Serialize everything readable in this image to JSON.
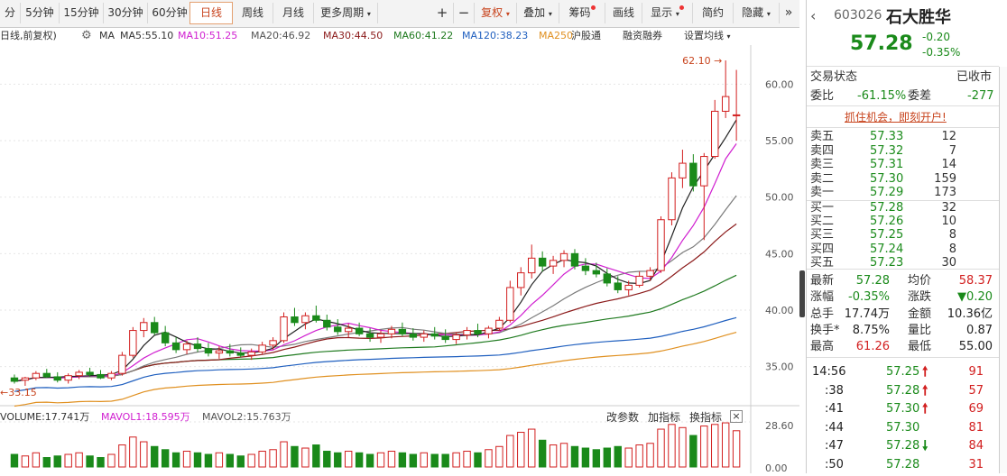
{
  "toolbar": {
    "items": [
      "分",
      "5分钟",
      "15分钟",
      "30分钟",
      "60分钟",
      "日线",
      "周线",
      "月线",
      "更多周期"
    ],
    "active": "日线",
    "plus": "+",
    "minus": "−",
    "fuquan": "复权",
    "diejia": "叠加",
    "chouma": "筹码",
    "huaxian": "画线",
    "xianshi": "显示",
    "jianyue": "简约",
    "yincang": "隐藏"
  },
  "ma_row": {
    "prefix": "日线,前复权)",
    "ma": "MA",
    "ma5": "MA5:55.10",
    "ma10": "MA10:51.25",
    "ma20": "MA20:46.92",
    "ma30": "MA30:44.50",
    "ma60": "MA60:41.22",
    "ma120": "MA120:38.23",
    "ma250": "MA250",
    "hgt": "沪股通",
    "rzrq": "融资融券",
    "settings": "设置均线"
  },
  "colors": {
    "ma5": "#222222",
    "ma10": "#d01fd0",
    "ma20": "#7a7a7a",
    "ma30": "#8b1a1a",
    "ma60": "#1f7a1f",
    "ma120": "#1f5fbf",
    "ma250": "#e09020",
    "up": "#d21f1f",
    "down": "#1a8a1a"
  },
  "chart_data": {
    "type": "candlestick",
    "y_ticks": [
      "60.00",
      "55.00",
      "50.00",
      "45.00",
      "40.00",
      "35.00"
    ],
    "y_tick_values": [
      60,
      55,
      50,
      45,
      40,
      35
    ],
    "ylim": [
      32.5,
      62.5
    ],
    "high_label": "62.10",
    "low_label": "33.15",
    "candles": [
      [
        34.0,
        34.3,
        33.5,
        33.7
      ],
      [
        33.8,
        34.1,
        33.3,
        34.0
      ],
      [
        34.0,
        34.6,
        33.8,
        34.4
      ],
      [
        34.4,
        34.8,
        34.0,
        34.1
      ],
      [
        34.1,
        34.5,
        33.6,
        33.8
      ],
      [
        33.8,
        34.4,
        33.5,
        34.2
      ],
      [
        34.2,
        34.7,
        33.9,
        34.5
      ],
      [
        34.5,
        34.9,
        34.1,
        34.3
      ],
      [
        34.3,
        34.7,
        33.9,
        34.0
      ],
      [
        34.0,
        34.6,
        33.8,
        34.4
      ],
      [
        34.4,
        36.3,
        34.2,
        36.0
      ],
      [
        36.0,
        38.5,
        35.8,
        38.2
      ],
      [
        38.2,
        39.3,
        37.6,
        38.9
      ],
      [
        38.9,
        39.4,
        37.8,
        38.0
      ],
      [
        38.0,
        38.6,
        36.8,
        37.1
      ],
      [
        37.1,
        37.6,
        36.2,
        36.5
      ],
      [
        36.5,
        37.3,
        36.1,
        37.0
      ],
      [
        37.0,
        37.6,
        36.3,
        36.6
      ],
      [
        36.6,
        37.1,
        35.9,
        36.2
      ],
      [
        36.2,
        36.8,
        35.7,
        36.4
      ],
      [
        36.4,
        37.0,
        35.9,
        36.2
      ],
      [
        36.2,
        36.7,
        35.8,
        36.0
      ],
      [
        36.0,
        36.6,
        35.6,
        36.3
      ],
      [
        36.3,
        37.2,
        36.1,
        36.9
      ],
      [
        36.9,
        37.6,
        36.5,
        37.3
      ],
      [
        37.3,
        39.8,
        37.1,
        39.4
      ],
      [
        39.4,
        40.2,
        38.6,
        38.9
      ],
      [
        38.9,
        39.8,
        38.3,
        39.5
      ],
      [
        39.5,
        40.4,
        38.9,
        39.1
      ],
      [
        39.1,
        39.6,
        38.2,
        38.5
      ],
      [
        38.5,
        39.2,
        37.8,
        38.1
      ],
      [
        38.1,
        38.8,
        37.6,
        38.4
      ],
      [
        38.4,
        38.9,
        37.7,
        37.9
      ],
      [
        37.9,
        38.4,
        37.2,
        37.6
      ],
      [
        37.6,
        38.2,
        37.1,
        37.9
      ],
      [
        37.9,
        38.6,
        37.5,
        38.3
      ],
      [
        38.3,
        38.9,
        37.7,
        37.9
      ],
      [
        37.9,
        38.4,
        37.3,
        37.6
      ],
      [
        37.6,
        38.2,
        37.2,
        37.9
      ],
      [
        37.9,
        38.5,
        37.4,
        37.7
      ],
      [
        37.7,
        38.3,
        37.1,
        37.4
      ],
      [
        37.4,
        38.0,
        37.0,
        37.8
      ],
      [
        37.8,
        38.5,
        37.4,
        38.2
      ],
      [
        38.2,
        38.8,
        37.6,
        37.9
      ],
      [
        37.9,
        38.6,
        37.5,
        38.4
      ],
      [
        38.4,
        39.4,
        38.2,
        39.1
      ],
      [
        39.1,
        42.6,
        38.9,
        42.0
      ],
      [
        42.0,
        43.8,
        41.3,
        43.3
      ],
      [
        43.3,
        45.8,
        42.8,
        44.6
      ],
      [
        44.6,
        45.2,
        43.4,
        43.9
      ],
      [
        43.9,
        44.8,
        43.2,
        44.4
      ],
      [
        44.4,
        45.3,
        43.8,
        45.0
      ],
      [
        45.0,
        45.4,
        43.6,
        43.9
      ],
      [
        43.9,
        44.6,
        43.1,
        43.5
      ],
      [
        43.5,
        44.2,
        42.9,
        43.2
      ],
      [
        43.2,
        43.7,
        42.1,
        42.4
      ],
      [
        42.4,
        43.0,
        41.5,
        41.8
      ],
      [
        41.8,
        42.6,
        41.3,
        42.2
      ],
      [
        42.2,
        43.4,
        42.0,
        43.0
      ],
      [
        43.0,
        43.8,
        42.6,
        43.5
      ],
      [
        43.5,
        48.3,
        43.3,
        48.0
      ],
      [
        48.0,
        52.2,
        47.5,
        51.7
      ],
      [
        51.7,
        54.2,
        50.8,
        53.0
      ],
      [
        53.0,
        53.8,
        50.5,
        51.0
      ],
      [
        51.0,
        53.9,
        46.2,
        53.6
      ],
      [
        53.6,
        58.6,
        53.4,
        57.6
      ],
      [
        57.6,
        62.1,
        57.0,
        58.9
      ],
      [
        57.2,
        61.26,
        55.0,
        57.28
      ]
    ]
  },
  "volume": {
    "label": "VOLUME:17.741万",
    "mavol1": "MAVOL1:18.595万",
    "mavol2": "MAVOL2:15.763万",
    "gaicanshu": "改参数",
    "jiazhibiao": "加指标",
    "huanzhibiao": "换指标",
    "y_ticks": [
      "28.60",
      "0.00"
    ],
    "values": [
      8,
      7,
      9,
      6,
      7,
      8,
      9,
      7,
      6,
      8,
      14,
      19,
      16,
      13,
      11,
      9,
      10,
      9,
      8,
      9,
      8,
      7,
      8,
      10,
      11,
      16,
      13,
      12,
      14,
      10,
      9,
      10,
      9,
      8,
      9,
      10,
      9,
      8,
      9,
      8,
      8,
      9,
      10,
      9,
      11,
      13,
      20,
      22,
      24,
      17,
      14,
      15,
      13,
      12,
      11,
      12,
      13,
      12,
      14,
      15,
      24,
      27,
      25,
      20,
      26,
      27,
      28,
      23
    ]
  },
  "quote": {
    "code": "603026",
    "name": "石大胜华",
    "price": "57.28",
    "change": "-0.20",
    "pct": "-0.35%",
    "status_label": "交易状态",
    "status_value": "已收市",
    "weibi_label": "委比",
    "weibi_value": "-61.15%",
    "weicha_label": "委差",
    "weicha_value": "-277",
    "promo": "抓住机会，即刻开户!",
    "asks": [
      {
        "label": "卖五",
        "price": "57.33",
        "vol": "12"
      },
      {
        "label": "卖四",
        "price": "57.32",
        "vol": "7"
      },
      {
        "label": "卖三",
        "price": "57.31",
        "vol": "14"
      },
      {
        "label": "卖二",
        "price": "57.30",
        "vol": "159"
      },
      {
        "label": "卖一",
        "price": "57.29",
        "vol": "173"
      }
    ],
    "bids": [
      {
        "label": "买一",
        "price": "57.28",
        "vol": "32"
      },
      {
        "label": "买二",
        "price": "57.26",
        "vol": "10"
      },
      {
        "label": "买三",
        "price": "57.25",
        "vol": "8"
      },
      {
        "label": "买四",
        "price": "57.24",
        "vol": "8"
      },
      {
        "label": "买五",
        "price": "57.23",
        "vol": "30"
      }
    ],
    "stats": [
      {
        "l1": "最新",
        "v1": "57.28",
        "c1": "green",
        "l2": "均价",
        "v2": "58.37",
        "c2": "red"
      },
      {
        "l1": "涨幅",
        "v1": "-0.35%",
        "c1": "green",
        "l2": "涨跌",
        "v2": "▼0.20",
        "c2": "green"
      },
      {
        "l1": "总手",
        "v1": "17.74万",
        "c1": "blk",
        "l2": "金额",
        "v2": "10.36亿",
        "c2": "blk"
      },
      {
        "l1": "换手*",
        "v1": "8.75%",
        "c1": "blk",
        "l2": "量比",
        "v2": "0.87",
        "c2": "blk"
      },
      {
        "l1": "最高",
        "v1": "61.26",
        "c1": "red",
        "l2": "最低",
        "v2": "55.00",
        "c2": "blk"
      }
    ],
    "ticks": [
      {
        "time": "14:56",
        "price": "57.25",
        "arrow": "up",
        "vol": "91"
      },
      {
        "time": ":38",
        "price": "57.28",
        "arrow": "up",
        "vol": "57"
      },
      {
        "time": ":41",
        "price": "57.30",
        "arrow": "up",
        "vol": "69"
      },
      {
        "time": ":44",
        "price": "57.30",
        "arrow": "",
        "vol": "81"
      },
      {
        "time": ":47",
        "price": "57.28",
        "arrow": "down",
        "vol": "84"
      },
      {
        "time": ":50",
        "price": "57.28",
        "arrow": "",
        "vol": "31"
      }
    ]
  }
}
